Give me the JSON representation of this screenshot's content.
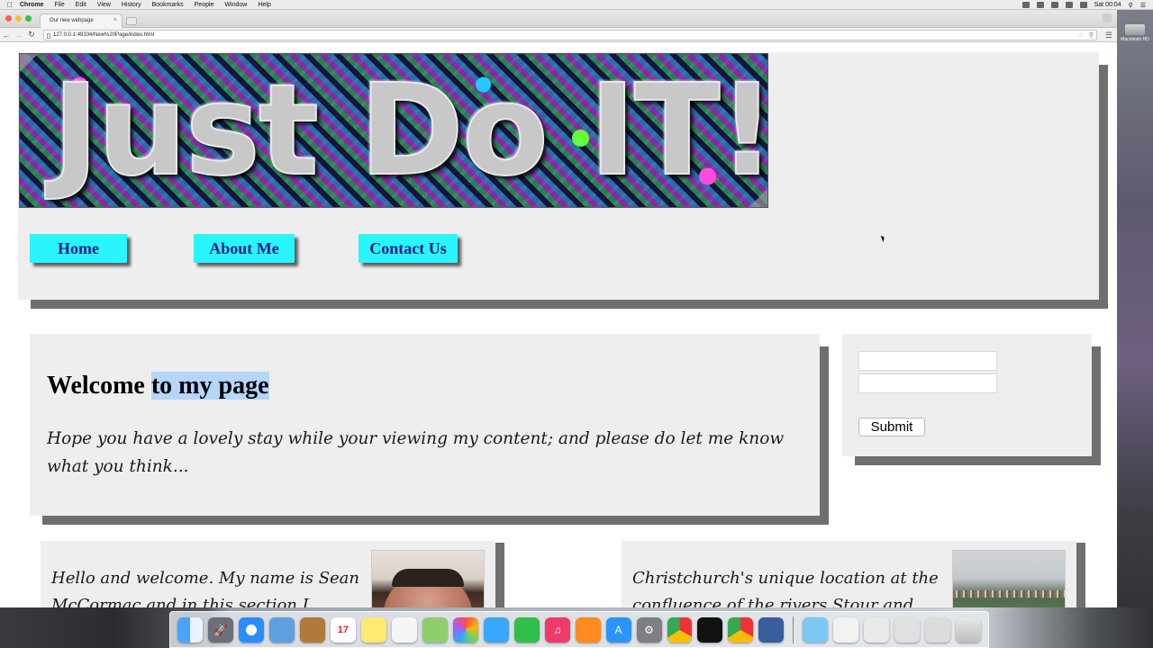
{
  "menubar": {
    "app": "Chrome",
    "items": [
      "File",
      "Edit",
      "View",
      "History",
      "Bookmarks",
      "People",
      "Window",
      "Help"
    ],
    "clock": "Sat 00:04"
  },
  "desktop": {
    "drive_label": "Macintosh HD"
  },
  "browser": {
    "tab_title": "Our new webpage",
    "url": "127.0.0.1:49334/New%20Page/index.html"
  },
  "page": {
    "banner_text": "Just Do IT!",
    "nav": {
      "home": "Home",
      "about": "About Me",
      "contact": "Contact Us"
    },
    "welcome": {
      "title_plain": "Welcome ",
      "title_highlight": "to my page",
      "text": "Hope you have a lovely stay while your viewing my content; and please do let me know what you think..."
    },
    "form": {
      "input1_value": "",
      "input2_value": "",
      "submit_label": "Submit"
    },
    "articles": [
      {
        "text": "Hello and welcome. My name is Sean McCormac and in this section I wanted"
      },
      {
        "text": "Christchurch's unique location at the confluence of the rivers Stour and Avon"
      }
    ]
  },
  "dock": {
    "icons": [
      "finder-icon",
      "launchpad-icon",
      "safari-icon",
      "preview-icon",
      "contacts-icon",
      "calendar-icon",
      "notes-icon",
      "reminders-icon",
      "maps-icon",
      "photos-icon",
      "messages-icon",
      "facetime-icon",
      "itunes-icon",
      "ibooks-icon",
      "app-store-icon",
      "system-preferences-icon",
      "chrome-icon",
      "terminal-icon",
      "chrome-canary-icon",
      "imovie-icon",
      "folder-icon",
      "documents-icon",
      "downloads-icon",
      "screenshots-icon",
      "stack-icon",
      "trash-icon"
    ],
    "calendar_day": "17"
  },
  "colors": {
    "nav_button_bg": "#29f6fc",
    "nav_button_text": "#0c1b8c",
    "panel_bg": "#efeeee",
    "panel_shadow": "#6f6f6f",
    "highlight": "#b5d5fb"
  }
}
